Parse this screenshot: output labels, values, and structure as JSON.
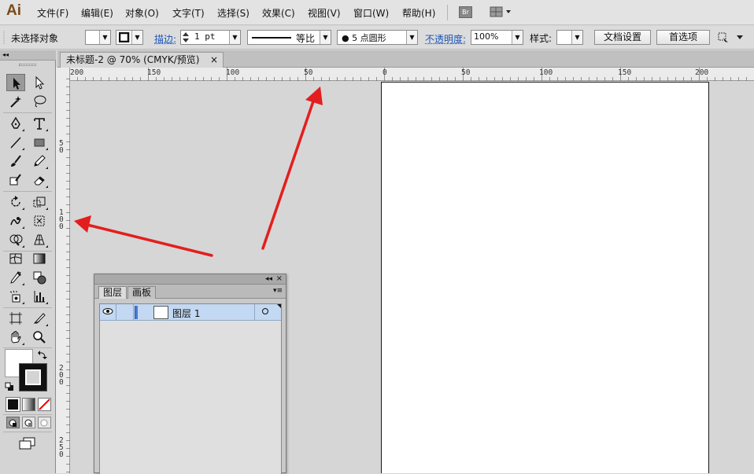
{
  "app": {
    "logo": "Ai"
  },
  "menu": [
    "文件(F)",
    "编辑(E)",
    "对象(O)",
    "文字(T)",
    "选择(S)",
    "效果(C)",
    "视图(V)",
    "窗口(W)",
    "帮助(H)"
  ],
  "menubar_extras": {
    "bridge_label": "Br"
  },
  "control_bar": {
    "selection_status": "未选择对象",
    "stroke_label": "描边:",
    "stroke_weight": "1 pt",
    "stroke_profile": "等比",
    "brush": "● 5 点圆形",
    "opacity_label": "不透明度:",
    "opacity_value": "100%",
    "style_label": "样式:",
    "doc_setup_button": "文档设置",
    "preferences_button": "首选项"
  },
  "document_tab": {
    "title": "未标题-2 @ 70% (CMYK/预览)",
    "close": "×"
  },
  "tool_panel": {
    "collapse": "◂◂"
  },
  "rulers": {
    "horizontal": [
      "200",
      "150",
      "100",
      "50",
      "0",
      "50",
      "100",
      "150",
      "200"
    ],
    "vertical": [
      "50",
      "100",
      "200",
      "250"
    ]
  },
  "layers_panel": {
    "collapse": "◂◂",
    "close": "×",
    "menu": "▾≡",
    "tabs": [
      "图层",
      "画板"
    ],
    "layers": [
      {
        "name": "图层 1"
      }
    ]
  },
  "colors": {
    "annotation_arrow": "#e41e1e",
    "layer_selected_bg": "#c3d8f2",
    "layer_color_bar": "#4a7bd0"
  }
}
